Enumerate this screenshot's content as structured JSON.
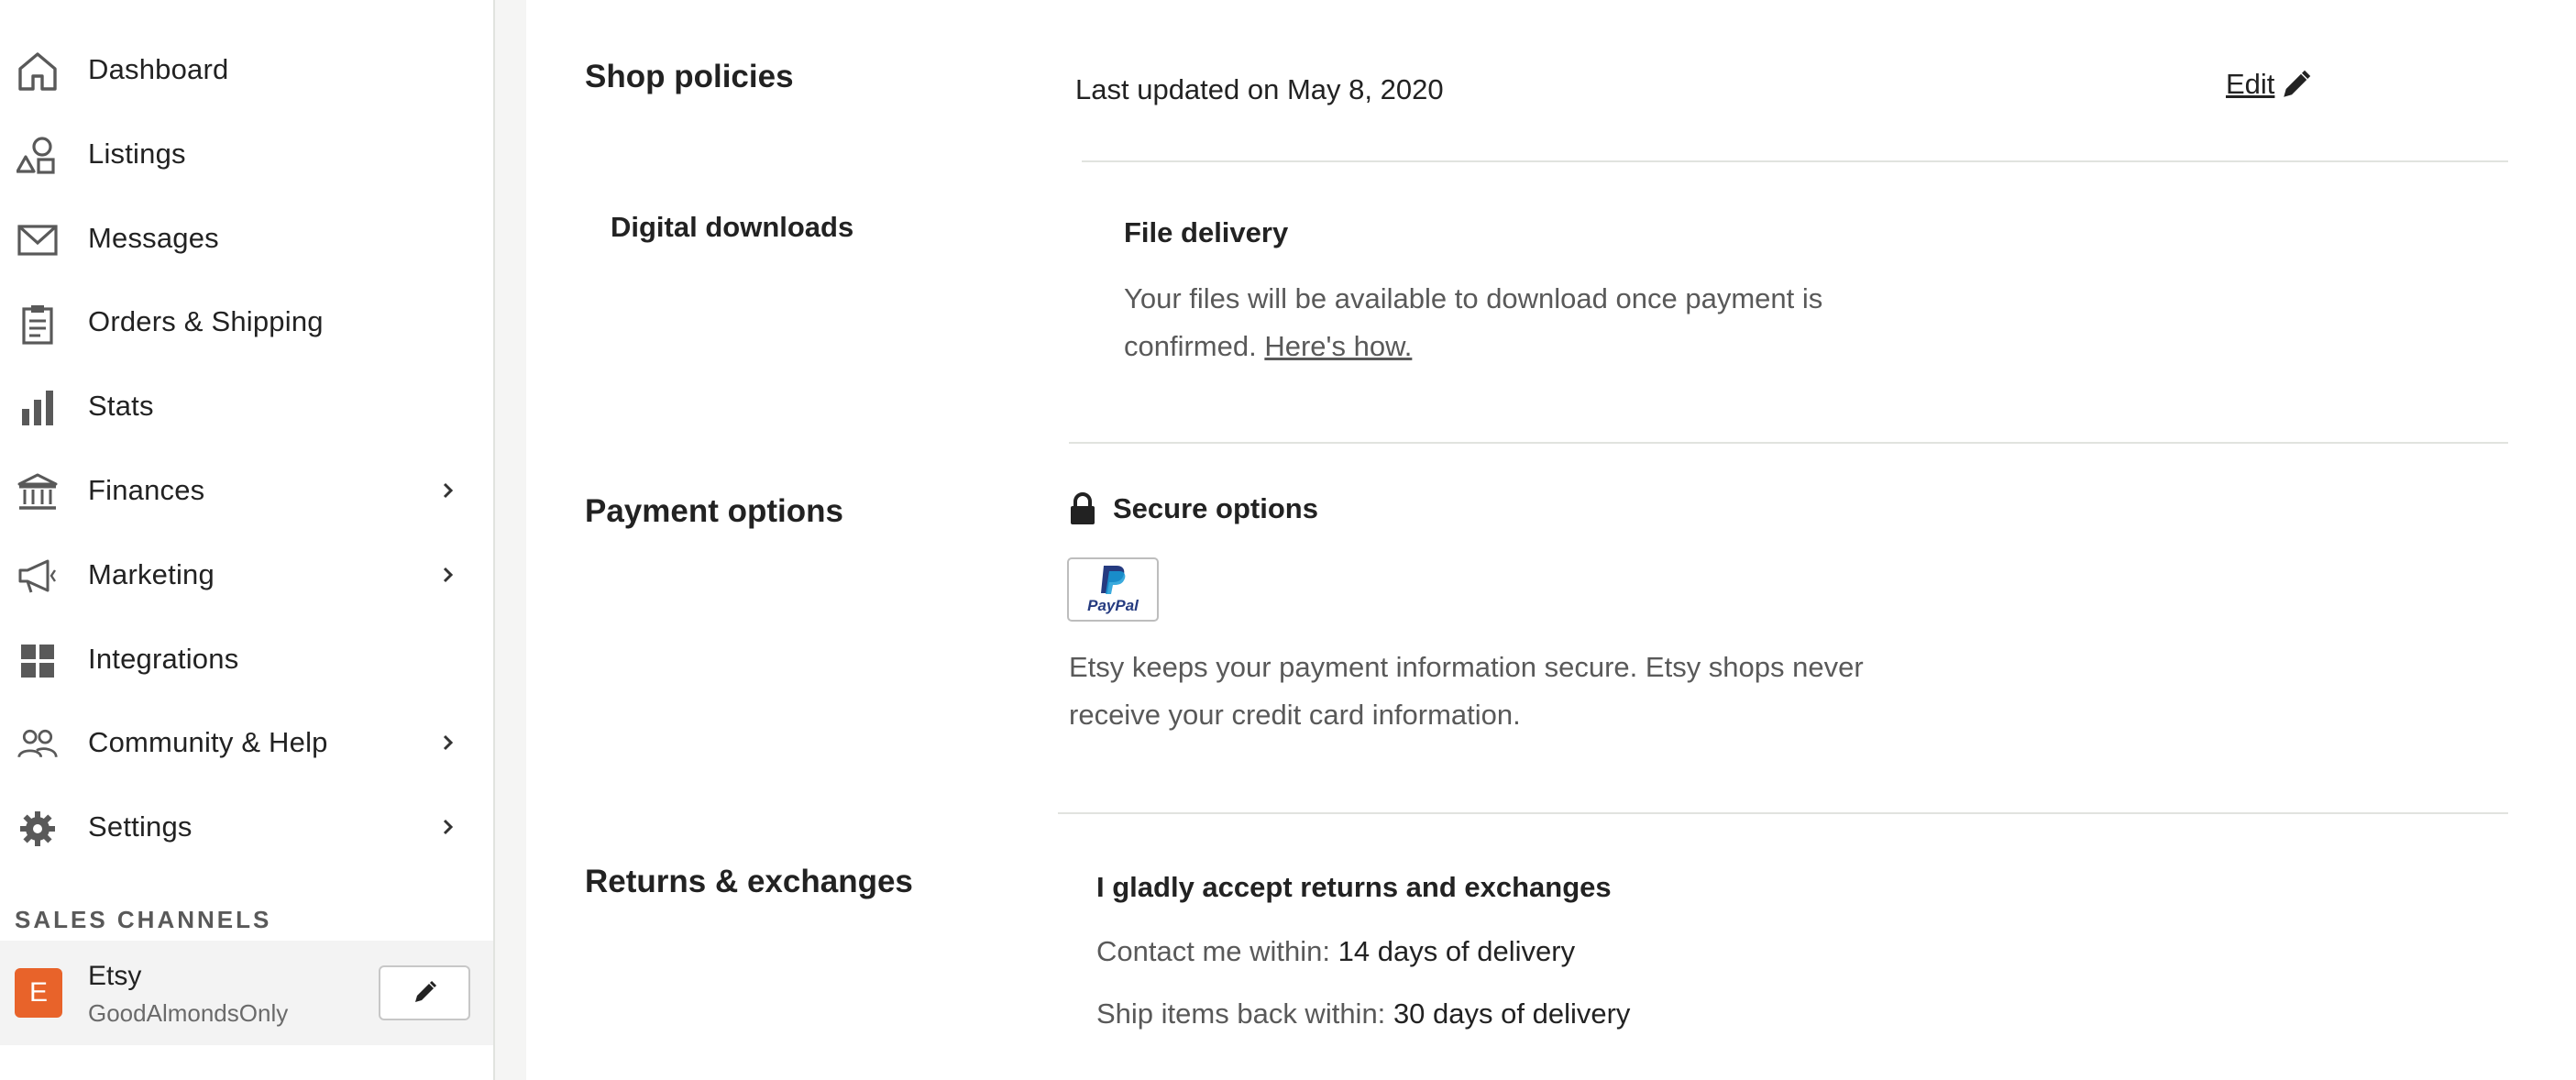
{
  "sidebar": {
    "items": [
      {
        "label": "Dashboard",
        "icon": "home-icon",
        "has_chevron": false
      },
      {
        "label": "Listings",
        "icon": "shapes-icon",
        "has_chevron": false
      },
      {
        "label": "Messages",
        "icon": "envelope-icon",
        "has_chevron": false
      },
      {
        "label": "Orders & Shipping",
        "icon": "clipboard-icon",
        "has_chevron": false
      },
      {
        "label": "Stats",
        "icon": "bar-chart-icon",
        "has_chevron": false
      },
      {
        "label": "Finances",
        "icon": "bank-icon",
        "has_chevron": true
      },
      {
        "label": "Marketing",
        "icon": "megaphone-icon",
        "has_chevron": true
      },
      {
        "label": "Integrations",
        "icon": "grid-icon",
        "has_chevron": false
      },
      {
        "label": "Community & Help",
        "icon": "people-icon",
        "has_chevron": true
      },
      {
        "label": "Settings",
        "icon": "gear-icon",
        "has_chevron": true
      }
    ],
    "sales_channels_heading": "SALES CHANNELS",
    "channel": {
      "avatar_letter": "E",
      "name": "Etsy",
      "shop_name": "GoodAlmondsOnly",
      "avatar_color": "#e8632a"
    }
  },
  "shop_policies": {
    "title": "Shop policies",
    "last_updated": "Last updated on May 8, 2020",
    "edit_label": "Edit"
  },
  "digital_downloads": {
    "title": "Digital downloads",
    "subtitle": "File delivery",
    "line1": "Your files will be available to download once payment is",
    "line2_prefix": "confirmed.",
    "link": "Here's how."
  },
  "payment_options": {
    "title": "Payment options",
    "subtitle": "Secure options",
    "paypal_logo": "PayPal",
    "line1": "Etsy keeps your payment information secure. Etsy shops never",
    "line2": "receive your credit card information."
  },
  "returns": {
    "title": "Returns & exchanges",
    "subtitle": "I gladly accept returns and exchanges",
    "contact_label": "Contact me within:",
    "contact_value": "14 days of delivery",
    "ship_label": "Ship items back within:",
    "ship_value": "30 days of delivery"
  }
}
